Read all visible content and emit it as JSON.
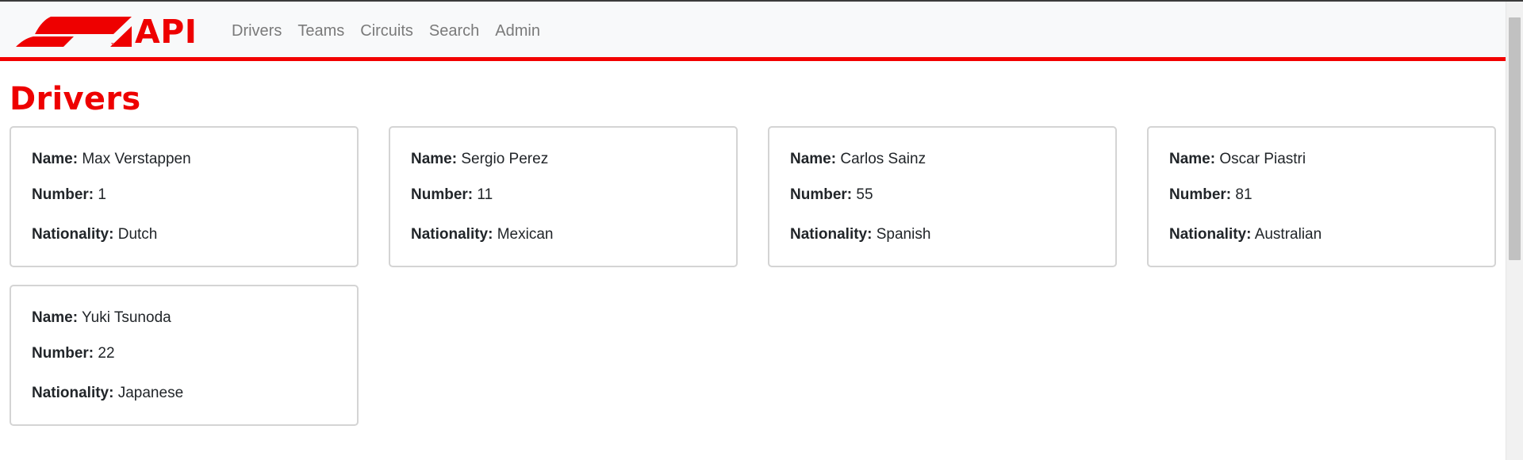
{
  "navbar": {
    "brand_text": "API",
    "links": [
      "Drivers",
      "Teams",
      "Circuits",
      "Search",
      "Admin"
    ],
    "accent_color": "#ee0000"
  },
  "page": {
    "title": "Drivers"
  },
  "labels": {
    "name": "Name:",
    "number": "Number:",
    "nationality": "Nationality:"
  },
  "drivers": [
    {
      "name": "Max Verstappen",
      "number": "1",
      "nationality": "Dutch"
    },
    {
      "name": "Sergio Perez",
      "number": "11",
      "nationality": "Mexican"
    },
    {
      "name": "Carlos Sainz",
      "number": "55",
      "nationality": "Spanish"
    },
    {
      "name": "Oscar Piastri",
      "number": "81",
      "nationality": "Australian"
    },
    {
      "name": "Yuki Tsunoda",
      "number": "22",
      "nationality": "Japanese"
    }
  ],
  "icons": {
    "brand_logo": "f1-logo-icon"
  }
}
